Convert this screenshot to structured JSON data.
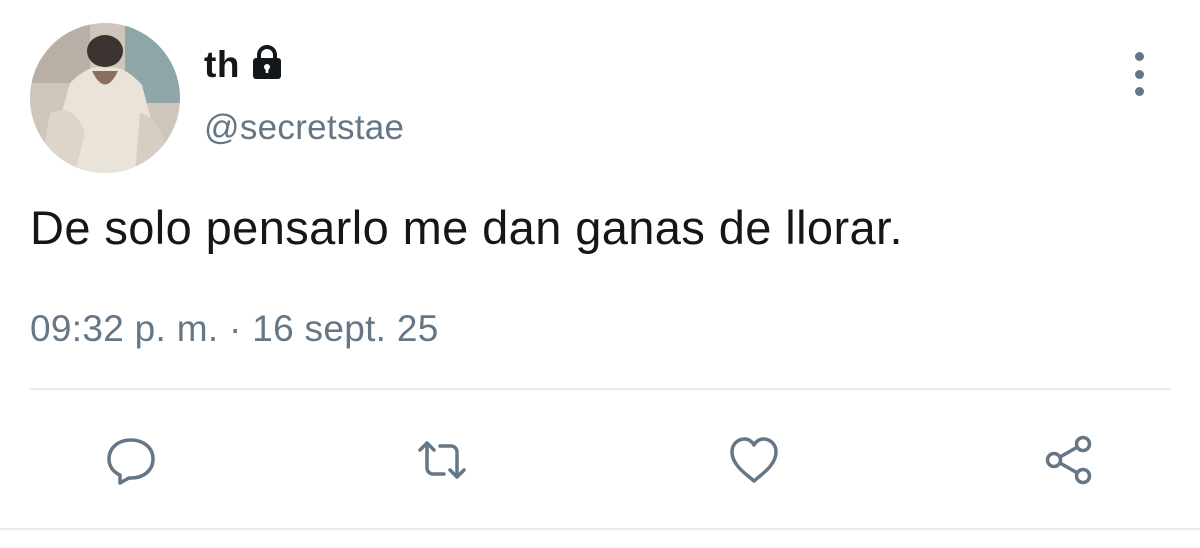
{
  "user": {
    "display_name": "th",
    "handle": "@secretstae",
    "protected": true,
    "avatar": "avatar-photo"
  },
  "tweet": {
    "text": "De solo pensarlo me dan ganas de llorar.",
    "timestamp": "09:32 p. m. · 16 sept. 25"
  },
  "icons": {
    "lock": "lock-icon",
    "more": "more-vertical-icon",
    "reply": "reply-icon",
    "retweet": "retweet-icon",
    "like": "heart-icon",
    "share": "share-icon"
  },
  "colors": {
    "text": "#14171a",
    "secondary": "#657786",
    "divider": "#e6ecf0"
  }
}
